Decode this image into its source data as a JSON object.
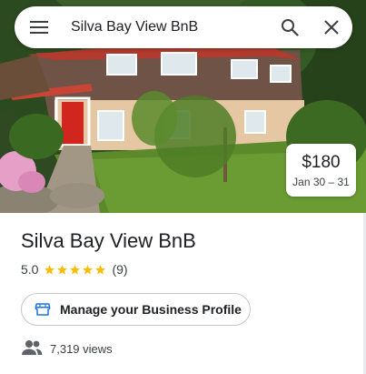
{
  "search": {
    "query": "Silva Bay View BnB",
    "icons": {
      "menu": "menu-icon",
      "search": "search-icon",
      "close": "close-icon"
    }
  },
  "price_card": {
    "price": "$180",
    "dates": "Jan 30 – 31"
  },
  "place": {
    "name": "Silva Bay View BnB",
    "rating": "5.0",
    "stars": 5,
    "reviews": "(9)"
  },
  "actions": {
    "manage_profile_label": "Manage your Business Profile",
    "manage_profile_icon": "storefront-icon"
  },
  "stats": {
    "views": "7,319 views",
    "views_icon": "people-icon"
  },
  "colors": {
    "star": "#fbbc04",
    "primary_text": "#202124",
    "secondary_text": "#3c4043",
    "icon_blue": "#1a73e8"
  }
}
